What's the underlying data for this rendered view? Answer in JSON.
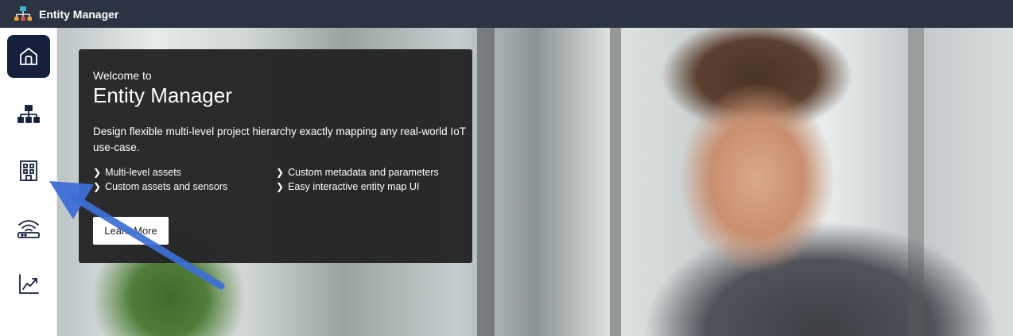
{
  "header": {
    "app_title": "Entity Manager",
    "logo_icon": "hierarchy-icon",
    "background": "#2c3342"
  },
  "sidebar": {
    "items": [
      {
        "id": "home",
        "icon": "home-icon",
        "active": true
      },
      {
        "id": "hierarchy",
        "icon": "hierarchy-icon",
        "active": false
      },
      {
        "id": "buildings",
        "icon": "building-icon",
        "active": false
      },
      {
        "id": "gateways",
        "icon": "wireless-router-icon",
        "active": false
      },
      {
        "id": "analytics",
        "icon": "trend-chart-icon",
        "active": false
      }
    ],
    "active_color": "#15213c"
  },
  "welcome": {
    "pre_title": "Welcome to",
    "title": "Entity Manager",
    "description": "Design flexible multi-level project hierarchy exactly mapping any real-world IoT use-case.",
    "features": [
      "Multi-level assets",
      "Custom metadata and parameters",
      "Custom assets and sensors",
      "Easy interactive entity map UI"
    ],
    "button_label": "Learn More"
  },
  "annotation": {
    "icon": "arrow-pointer-icon",
    "color": "#3d6fd6"
  }
}
